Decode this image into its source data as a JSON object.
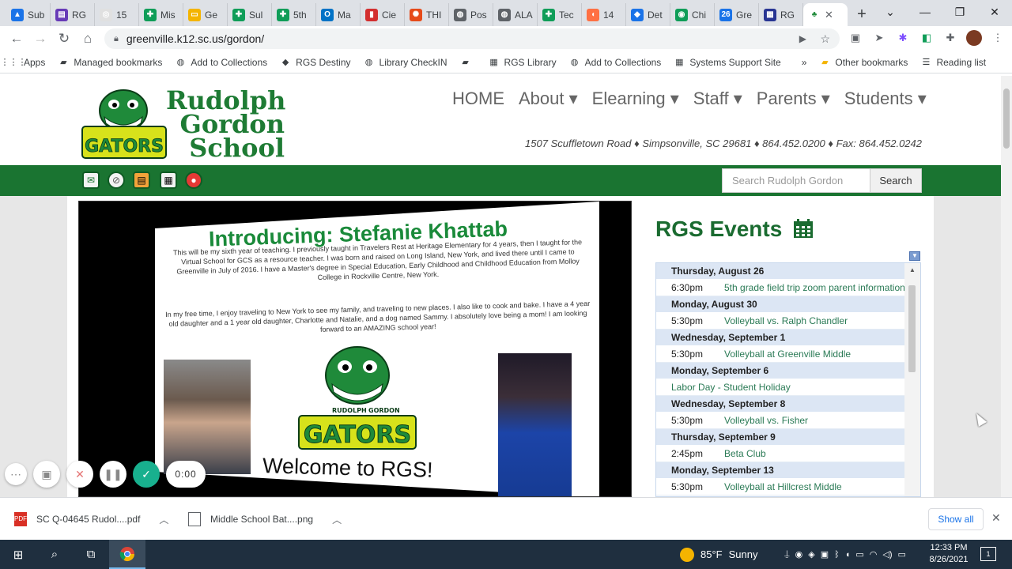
{
  "browser": {
    "tabs": [
      {
        "label": "Sub",
        "color": "#1a73e8",
        "glyph": "▲"
      },
      {
        "label": "RG",
        "color": "#673ab7",
        "glyph": "▤"
      },
      {
        "label": "15",
        "color": "#e0e0e0",
        "glyph": "◎"
      },
      {
        "label": "Mis",
        "color": "#0f9d58",
        "glyph": "✚"
      },
      {
        "label": "Ge",
        "color": "#f4b400",
        "glyph": "▭"
      },
      {
        "label": "Sul",
        "color": "#0f9d58",
        "glyph": "✚"
      },
      {
        "label": "5th",
        "color": "#0f9d58",
        "glyph": "✚"
      },
      {
        "label": "Ma",
        "color": "#0072c6",
        "glyph": "O"
      },
      {
        "label": "Cie",
        "color": "#d32f2f",
        "glyph": "▮"
      },
      {
        "label": "THI",
        "color": "#e64a19",
        "glyph": "✺"
      },
      {
        "label": "Pos",
        "color": "#5f6368",
        "glyph": "◍"
      },
      {
        "label": "ALA",
        "color": "#5f6368",
        "glyph": "◍"
      },
      {
        "label": "Tec",
        "color": "#0f9d58",
        "glyph": "✚"
      },
      {
        "label": "14",
        "color": "#ff7043",
        "glyph": "◖"
      },
      {
        "label": "Det",
        "color": "#1a73e8",
        "glyph": "◆"
      },
      {
        "label": "Chi",
        "color": "#0f9d58",
        "glyph": "◉"
      },
      {
        "label": "Gre",
        "color": "#1a73e8",
        "glyph": "26"
      },
      {
        "label": "RG",
        "color": "#283593",
        "glyph": "▦"
      }
    ],
    "active_tab_close": "✕",
    "new_tab": "+",
    "url": "greenville.k12.sc.us/gordon/",
    "bookmarks": [
      {
        "label": "Apps",
        "icon": "apps-icon",
        "glyph": "⋮⋮⋮"
      },
      {
        "label": "Managed bookmarks",
        "icon": "folder-icon",
        "glyph": "▰"
      },
      {
        "label": "Add to Collections",
        "icon": "globe-icon",
        "glyph": "◍"
      },
      {
        "label": "RGS Destiny",
        "icon": "destiny-icon",
        "glyph": "◆"
      },
      {
        "label": "Library CheckIN",
        "icon": "globe-icon",
        "glyph": "◍"
      },
      {
        "label": "",
        "icon": "chat-icon",
        "glyph": "▰"
      },
      {
        "label": "RGS Library",
        "icon": "library-icon",
        "glyph": "▦"
      },
      {
        "label": "Add to Collections",
        "icon": "globe-icon",
        "glyph": "◍"
      },
      {
        "label": "Systems Support Site",
        "icon": "site-icon",
        "glyph": "▦"
      }
    ],
    "bookmarks_overflow": "»",
    "other_bookmarks": "Other bookmarks",
    "reading_list": "Reading list"
  },
  "site": {
    "school_name_line1": "Rudolph",
    "school_name_line2": "Gordon",
    "school_name_line3": "School",
    "nav": [
      "HOME",
      "About ▾",
      "Elearning ▾",
      "Staff ▾",
      "Parents ▾",
      "Students ▾"
    ],
    "address": "1507 Scuffletown Road ♦ Simpsonville, SC 29681 ♦ 864.452.0200 ♦ Fax: 864.452.0242",
    "search_placeholder": "Search Rudolph Gordon",
    "search_button": "Search"
  },
  "slide": {
    "title": "Introducing:  Stefanie Khattab",
    "paragraph1": "This will be my sixth year of teaching. I previously taught in Travelers Rest at Heritage Elementary for 4 years, then I taught for the Virtual School for GCS as a resource teacher. I was born and raised on Long Island, New York, and lived there until I came to Greenville in July of 2016. I have a Master's degree in Special Education, Early Childhood and Childhood Education from Molloy College in Rockville Centre, New York.",
    "paragraph2": "In my free time, I enjoy traveling to New York to see my family, and traveling to new places. I also like to cook and bake. I have a 4 year old daughter and a 1 year old daughter, Charlotte and Natalie, and a dog named Sammy. I absolutely love being a mom! I am looking forward to an AMAZING school year!",
    "welcome": "Welcome to RGS!",
    "logo_top_left": "RUDOLPH",
    "logo_top_right": "GORDON",
    "logo_word": "GATORS"
  },
  "events": {
    "title": "RGS Events",
    "rows": [
      {
        "type": "date",
        "text": "Thursday, August 26"
      },
      {
        "type": "item",
        "time": "6:30pm",
        "title": "5th grade field trip zoom parent information"
      },
      {
        "type": "date",
        "text": "Monday, August 30"
      },
      {
        "type": "item",
        "time": "5:30pm",
        "title": "Volleyball vs. Ralph Chandler"
      },
      {
        "type": "date",
        "text": "Wednesday, September 1"
      },
      {
        "type": "item",
        "time": "5:30pm",
        "title": "Volleyball at Greenville Middle"
      },
      {
        "type": "date",
        "text": "Monday, September 6"
      },
      {
        "type": "item",
        "time": "",
        "title": "Labor Day - Student Holiday"
      },
      {
        "type": "date",
        "text": "Wednesday, September 8"
      },
      {
        "type": "item",
        "time": "5:30pm",
        "title": "Volleyball vs. Fisher"
      },
      {
        "type": "date",
        "text": "Thursday, September 9"
      },
      {
        "type": "item",
        "time": "2:45pm",
        "title": "Beta Club"
      },
      {
        "type": "date",
        "text": "Monday, September 13"
      },
      {
        "type": "item",
        "time": "5:30pm",
        "title": "Volleyball at Hillcrest Middle"
      }
    ]
  },
  "loom": {
    "timer": "0:00"
  },
  "downloads": {
    "items": [
      {
        "name": "SC Q-04645 Rudol....pdf",
        "kind": "PDF"
      },
      {
        "name": "Middle School Bat....png",
        "kind": "IMG"
      }
    ],
    "show_all": "Show all",
    "close": "✕"
  },
  "taskbar": {
    "weather_temp": "85°F",
    "weather_text": "Sunny",
    "time": "12:33 PM",
    "date": "8/26/2021",
    "notification_count": "1"
  }
}
